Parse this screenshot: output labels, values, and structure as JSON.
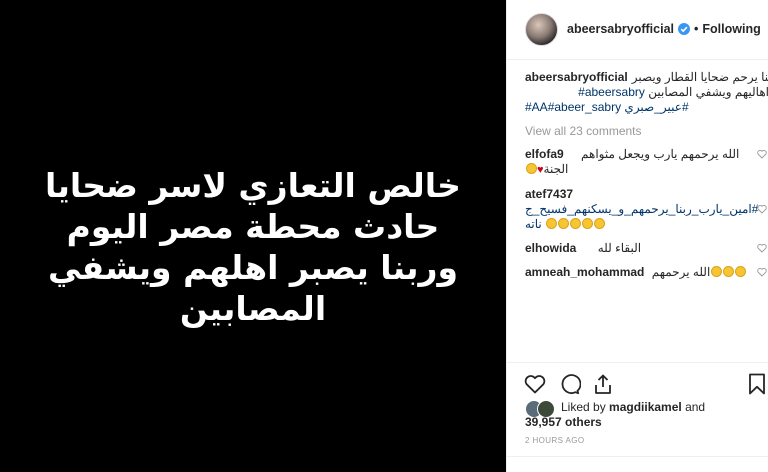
{
  "media": {
    "lines": [
      "خالص التعازي لاسر ضحايا",
      "حادث محطة مصر اليوم",
      "وربنا يصبر اهلهم ويشفي",
      "المصابين"
    ]
  },
  "header": {
    "username": "abeersabryofficial",
    "separator": "•",
    "follow_status": "Following"
  },
  "caption": {
    "username": "abeersabryofficial",
    "text_line1": "ربنا يرحم ضحايا القطار ويصبر",
    "text_line2": "اهاليهم ويشفي المصابين",
    "hashtag1": "#abeersabry",
    "hashtag2": "#AA",
    "hashtag3": "#abeer_sabry",
    "hashtag4": "#عبير_صبري"
  },
  "view_all": "View all 23 comments",
  "comments": [
    {
      "username": "elfofa9",
      "text": "الله يرحمهم يارب ويجعل مثواهم",
      "text2": "الجنة"
    },
    {
      "username": "atef7437",
      "text": "#امين_يارب_ربنا_يرحمهم_و_يسكنهم_فسيح_ج",
      "text2": "ناته"
    },
    {
      "username": "elhowida",
      "text": "البقاء لله"
    },
    {
      "username": "amneah_mohammad",
      "text": "الله يرحمهم"
    }
  ],
  "likes": {
    "prefix": "Liked by ",
    "user": "magdiikamel",
    "middle": " and",
    "count": "39,957 others"
  },
  "timestamp": "2 HOURS AGO",
  "icons": [
    "verified-badge-icon",
    "heart-icon",
    "comment-icon",
    "share-icon",
    "bookmark-icon"
  ],
  "colors": {
    "hashtag": "#003569",
    "verified": "#3897f0",
    "muted": "#999999"
  }
}
